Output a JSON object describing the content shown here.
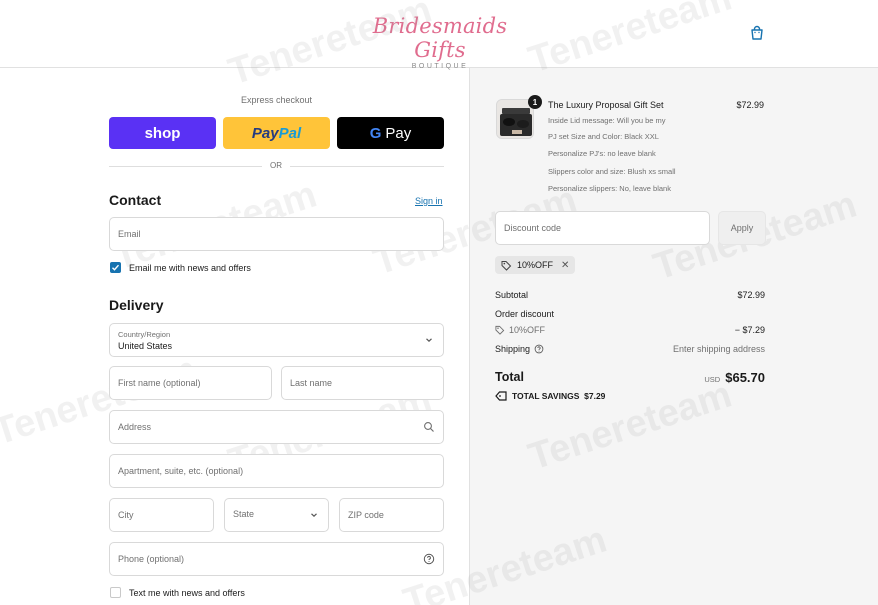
{
  "header": {
    "logo_main": "Bridesmaids Gifts",
    "logo_sub": "BOUTIQUE",
    "cart_icon": "shopping-bag-icon"
  },
  "express": {
    "title": "Express checkout",
    "shop_label": "shop",
    "paypal_label_1": "Pay",
    "paypal_label_2": "Pal",
    "gpay_g": "G",
    "gpay_label": "Pay",
    "or_label": "OR"
  },
  "contact": {
    "title": "Contact",
    "signin": "Sign in",
    "email_placeholder": "Email",
    "news_label": "Email me with news and offers",
    "news_checked": true
  },
  "delivery": {
    "title": "Delivery",
    "country_label": "Country/Region",
    "country_value": "United States",
    "first_name_placeholder": "First name (optional)",
    "last_name_placeholder": "Last name",
    "address_placeholder": "Address",
    "apartment_placeholder": "Apartment, suite, etc. (optional)",
    "city_placeholder": "City",
    "state_placeholder": "State",
    "zip_placeholder": "ZIP code",
    "phone_placeholder": "Phone (optional)",
    "text_offers_label": "Text me with news and offers",
    "text_offers_checked": false
  },
  "order": {
    "product": {
      "name": "The Luxury Proposal Gift Set",
      "price": "$72.99",
      "quantity": "1",
      "options": [
        "Inside Lid message: Will you be my",
        "PJ set Size and Color: Black XXL",
        "Personalize PJ's: no leave blank",
        "Slippers color and size: Blush xs small",
        "Personalize slippers: No, leave blank"
      ]
    },
    "discount_placeholder": "Discount code",
    "apply_label": "Apply",
    "applied_code": "10%OFF",
    "subtotal_label": "Subtotal",
    "subtotal_value": "$72.99",
    "order_discount_label": "Order discount",
    "discount_code_label": "10%OFF",
    "discount_value": "− $7.29",
    "shipping_label": "Shipping",
    "shipping_value": "Enter shipping address",
    "total_label": "Total",
    "total_currency": "USD",
    "total_value": "$65.70",
    "savings_label": "TOTAL SAVINGS",
    "savings_value": "$7.29"
  },
  "watermark": "Tenereteam",
  "colors": {
    "shop": "#5a31f4",
    "paypal": "#ffc439",
    "gpay": "#000000",
    "link": "#1773b0",
    "logo": "#e06c8e"
  }
}
